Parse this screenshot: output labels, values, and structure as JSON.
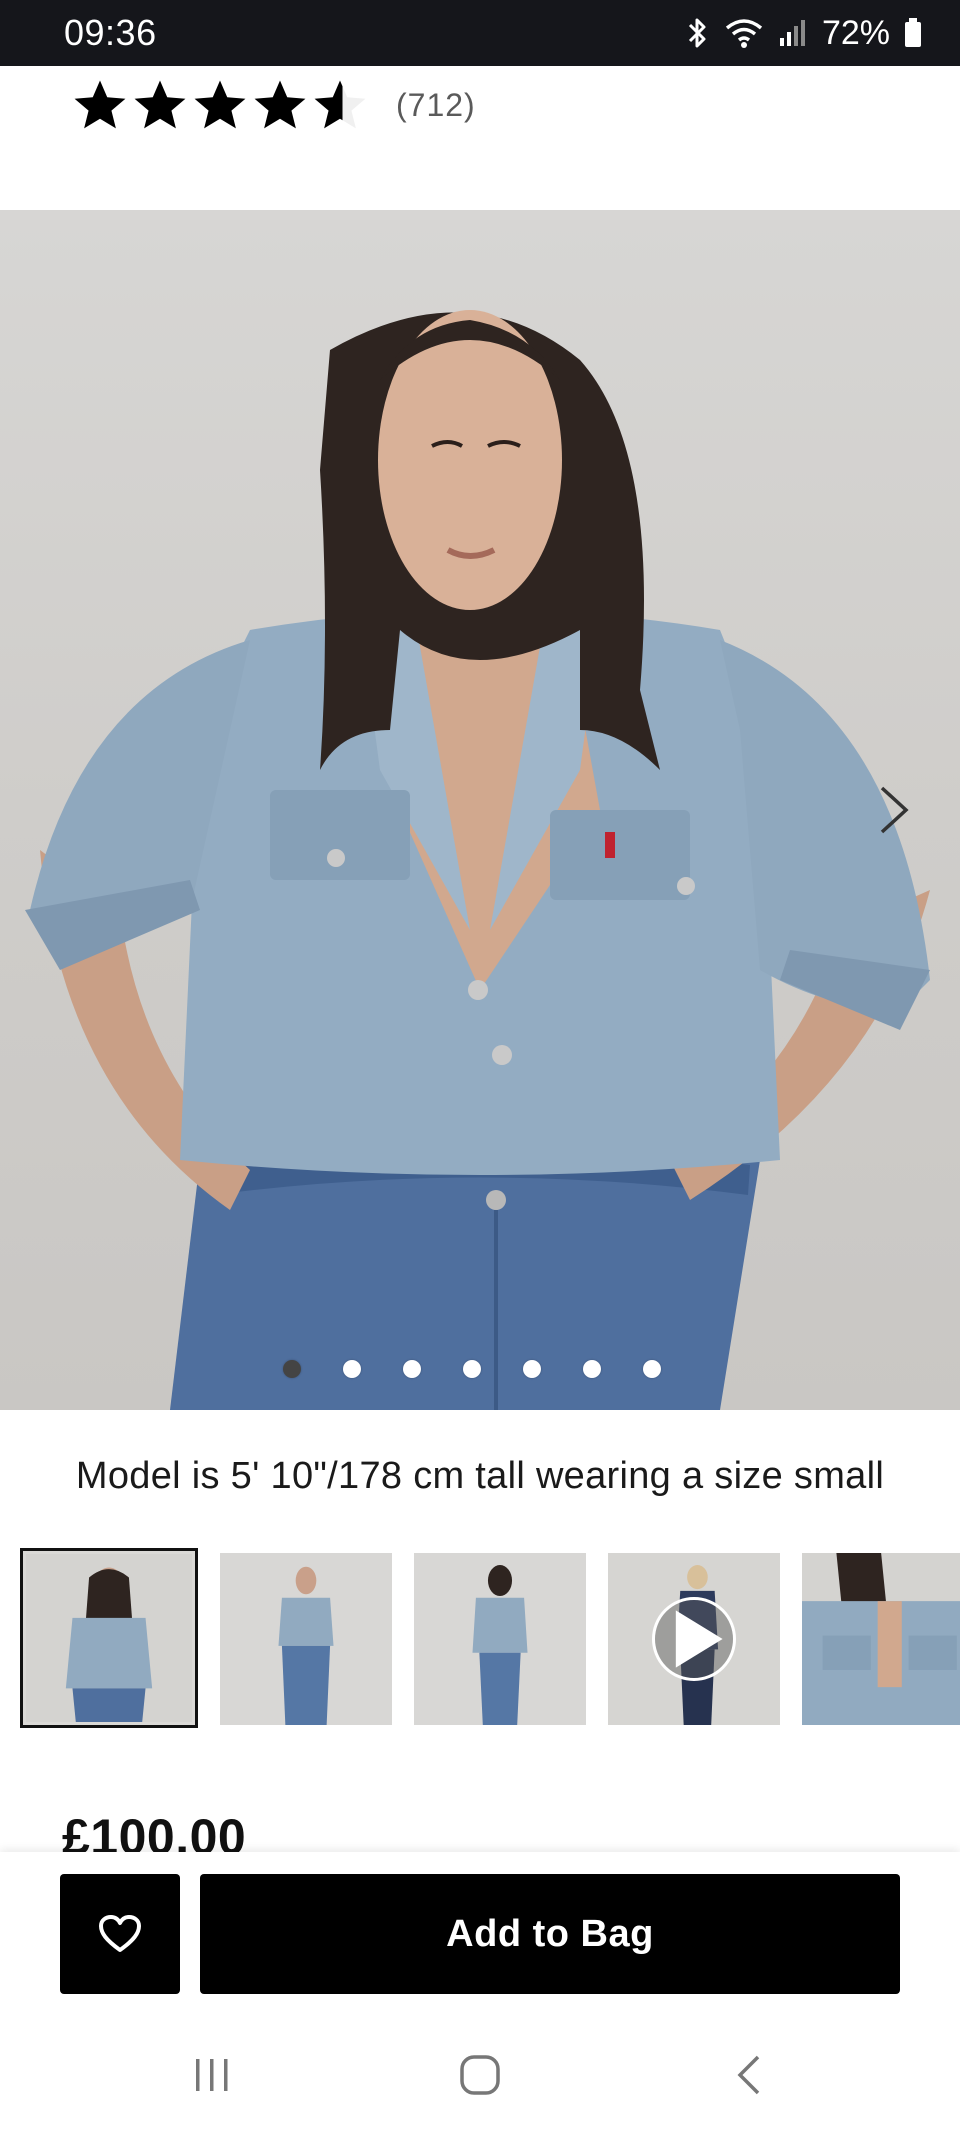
{
  "status_bar": {
    "time": "09:36",
    "battery": "72%",
    "icons": [
      "bluetooth-icon",
      "wifi-icon",
      "signal-icon",
      "battery-icon"
    ]
  },
  "product": {
    "rating": 4.5,
    "rating_count": "(712)",
    "model_caption": "Model is 5' 10\"/178 cm tall wearing a size small",
    "price": "£100.00"
  },
  "gallery": {
    "image_count": 7,
    "active_index": 0,
    "thumbnails": [
      {
        "kind": "image",
        "selected": true
      },
      {
        "kind": "image",
        "selected": false
      },
      {
        "kind": "image",
        "selected": false
      },
      {
        "kind": "video",
        "selected": false
      },
      {
        "kind": "image",
        "selected": false
      }
    ]
  },
  "actions": {
    "add_to_bag": "Add to Bag",
    "wishlist_icon": "heart-icon"
  },
  "navigation": {
    "icons": [
      "recent-apps-icon",
      "home-icon",
      "back-icon"
    ]
  },
  "colors": {
    "status_bar_bg": "#15161b",
    "button_bg": "#000000",
    "denim_light": "#8fa8be",
    "denim_dark": "#4f6f9e"
  }
}
